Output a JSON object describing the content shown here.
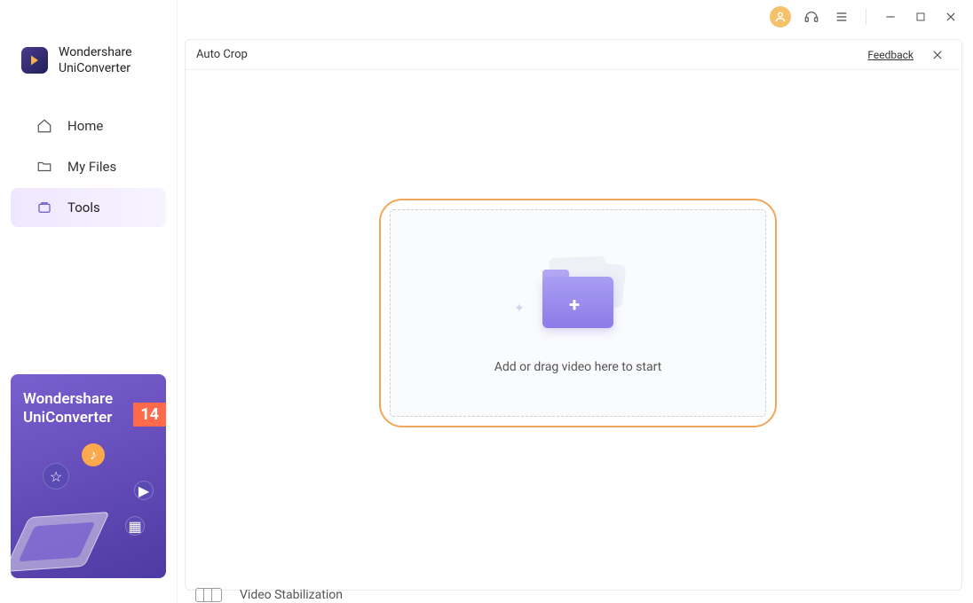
{
  "brand": {
    "line1": "Wondershare",
    "line2": "UniConverter"
  },
  "nav": {
    "home": "Home",
    "myfiles": "My Files",
    "tools": "Tools"
  },
  "promo": {
    "title_line1": "Wondershare",
    "title_line2": "UniConverter",
    "badge": "14"
  },
  "panel": {
    "title": "Auto Crop",
    "feedback": "Feedback",
    "drop_text": "Add or drag video here to start"
  },
  "peek": {
    "label": "Video Stabilization"
  }
}
